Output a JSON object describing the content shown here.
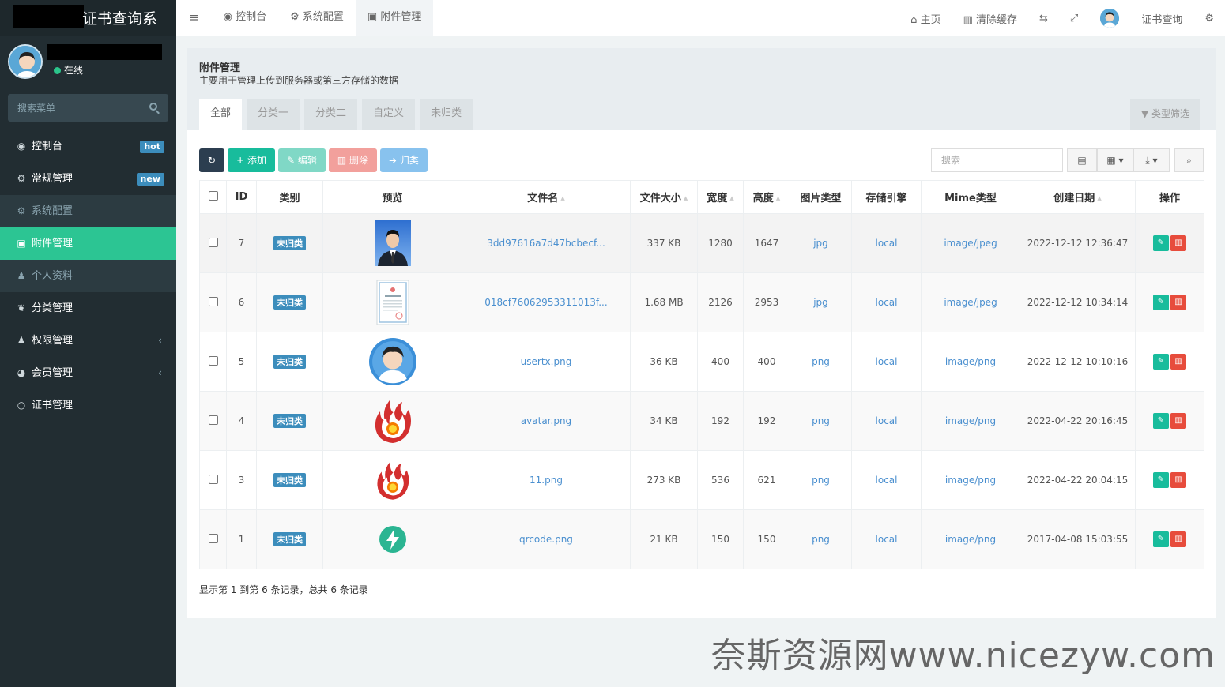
{
  "sidebar": {
    "app_title": "证书查询系",
    "status": "在线",
    "search_placeholder": "搜索菜单",
    "items": [
      {
        "label": "控制台",
        "icon": "dashboard-icon",
        "glyph": "◉",
        "badge": "hot",
        "badge_color": "#3c8dbc"
      },
      {
        "label": "常规管理",
        "icon": "cogs-icon",
        "glyph": "⚙",
        "badge": "new",
        "badge_color": "#3c8dbc"
      },
      {
        "label": "系统配置",
        "icon": "gear-icon",
        "glyph": "⚙"
      },
      {
        "label": "附件管理",
        "icon": "file-image-icon",
        "glyph": "▣"
      },
      {
        "label": "个人资料",
        "icon": "user-icon",
        "glyph": "♟"
      },
      {
        "label": "分类管理",
        "icon": "leaf-icon",
        "glyph": "❦"
      },
      {
        "label": "权限管理",
        "icon": "group-icon",
        "glyph": "♟"
      },
      {
        "label": "会员管理",
        "icon": "user-circle-icon",
        "glyph": "◕"
      },
      {
        "label": "证书管理",
        "icon": "circle-icon",
        "glyph": "○"
      }
    ]
  },
  "topnav": {
    "tabs": [
      "控制台",
      "系统配置",
      "附件管理"
    ],
    "right": [
      "主页",
      "清除缓存",
      "证书查询"
    ]
  },
  "page": {
    "title": "附件管理",
    "subtitle": "主要用于管理上传到服务器或第三方存储的数据",
    "tabs": [
      "全部",
      "分类一",
      "分类二",
      "自定义",
      "未归类"
    ],
    "filter_label": "类型筛选"
  },
  "toolbar": {
    "add": "添加",
    "edit": "编辑",
    "delete": "删除",
    "classify": "归类",
    "search_placeholder": "搜索"
  },
  "table": {
    "headers": [
      "ID",
      "类别",
      "预览",
      "文件名",
      "文件大小",
      "宽度",
      "高度",
      "图片类型",
      "存储引擎",
      "Mime类型",
      "创建日期",
      "操作"
    ],
    "rows": [
      {
        "id": "7",
        "cat": "未归类",
        "preview": "portrait-thumbnail",
        "name": "3dd97616a7d47bcbecf...",
        "size": "337 KB",
        "w": "1280",
        "h": "1647",
        "type": "jpg",
        "engine": "local",
        "mime": "image/jpeg",
        "date": "2022-12-12 12:36:47"
      },
      {
        "id": "6",
        "cat": "未归类",
        "preview": "certificate-thumbnail",
        "name": "018cf76062953311013f...",
        "size": "1.68 MB",
        "w": "2126",
        "h": "2953",
        "type": "jpg",
        "engine": "local",
        "mime": "image/jpeg",
        "date": "2022-12-12 10:34:14"
      },
      {
        "id": "5",
        "cat": "未归类",
        "preview": "avatar-thumbnail",
        "name": "usertx.png",
        "size": "36 KB",
        "w": "400",
        "h": "400",
        "type": "png",
        "engine": "local",
        "mime": "image/png",
        "date": "2022-12-12 10:10:16"
      },
      {
        "id": "4",
        "cat": "未归类",
        "preview": "flame-thumbnail",
        "name": "avatar.png",
        "size": "34 KB",
        "w": "192",
        "h": "192",
        "type": "png",
        "engine": "local",
        "mime": "image/png",
        "date": "2022-04-22 20:16:45"
      },
      {
        "id": "3",
        "cat": "未归类",
        "preview": "flame-thumbnail",
        "name": "11.png",
        "size": "273 KB",
        "w": "536",
        "h": "621",
        "type": "png",
        "engine": "local",
        "mime": "image/png",
        "date": "2022-04-22 20:04:15"
      },
      {
        "id": "1",
        "cat": "未归类",
        "preview": "qrcode-bolt-thumbnail",
        "name": "qrcode.png",
        "size": "21 KB",
        "w": "150",
        "h": "150",
        "type": "png",
        "engine": "local",
        "mime": "image/png",
        "date": "2017-04-08 15:03:55"
      }
    ],
    "footer": "显示第 1 到第 6 条记录，总共 6 条记录"
  },
  "watermark": "奈斯资源网www.nicezyw.com"
}
